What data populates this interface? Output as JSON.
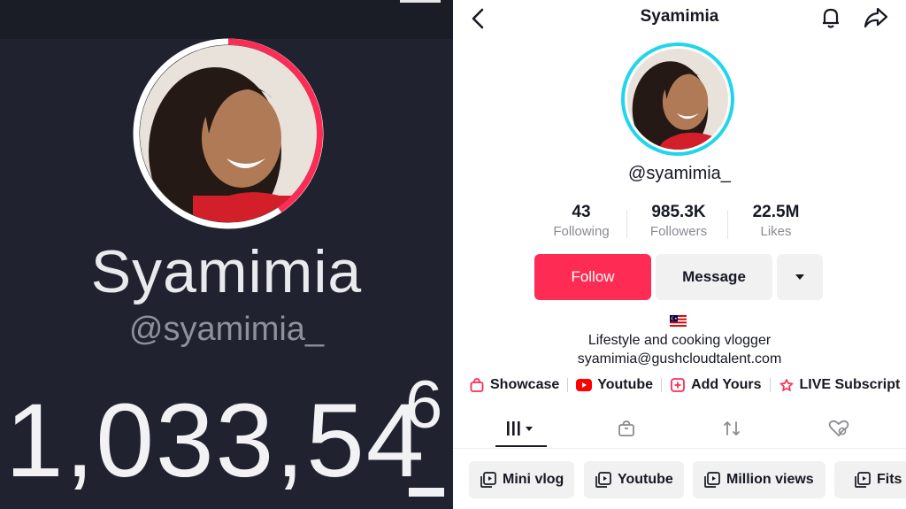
{
  "left": {
    "display_name": "Syamimia",
    "handle": "@syamimia_",
    "follower_count_main": "1,033,54",
    "follower_count_last_digit": "6",
    "colors": {
      "background": "#20232f",
      "ring_progress": "#fe2c55"
    }
  },
  "right": {
    "title": "Syamimia",
    "handle": "@syamimia_",
    "stats": [
      {
        "value": "43",
        "label": "Following"
      },
      {
        "value": "985.3K",
        "label": "Followers"
      },
      {
        "value": "22.5M",
        "label": "Likes"
      }
    ],
    "buttons": {
      "follow": "Follow",
      "message": "Message"
    },
    "bio_flag_icon": "malaysia-flag-icon",
    "bio": [
      "Lifestyle and cooking vlogger",
      "syamimia@gushcloudtalent.com"
    ],
    "links": [
      {
        "label": "Showcase",
        "icon": "shopping-bag-icon"
      },
      {
        "label": "Youtube",
        "icon": "youtube-icon"
      },
      {
        "label": "Add Yours",
        "icon": "add-yours-icon"
      },
      {
        "label": "LIVE Subscript",
        "icon": "live-subscription-icon"
      }
    ],
    "tabs": [
      {
        "name": "videos",
        "icon": "grid-icon"
      },
      {
        "name": "shop",
        "icon": "bag-icon"
      },
      {
        "name": "reposts",
        "icon": "repost-icon"
      },
      {
        "name": "liked",
        "icon": "hidden-heart-icon"
      }
    ],
    "playlists": [
      "Mini vlog",
      "Youtube",
      "Million views",
      "Fits"
    ],
    "colors": {
      "accent": "#fe2c55",
      "story_ring": "#20d5ec",
      "text": "#161823",
      "muted": "#8a8b91"
    }
  }
}
